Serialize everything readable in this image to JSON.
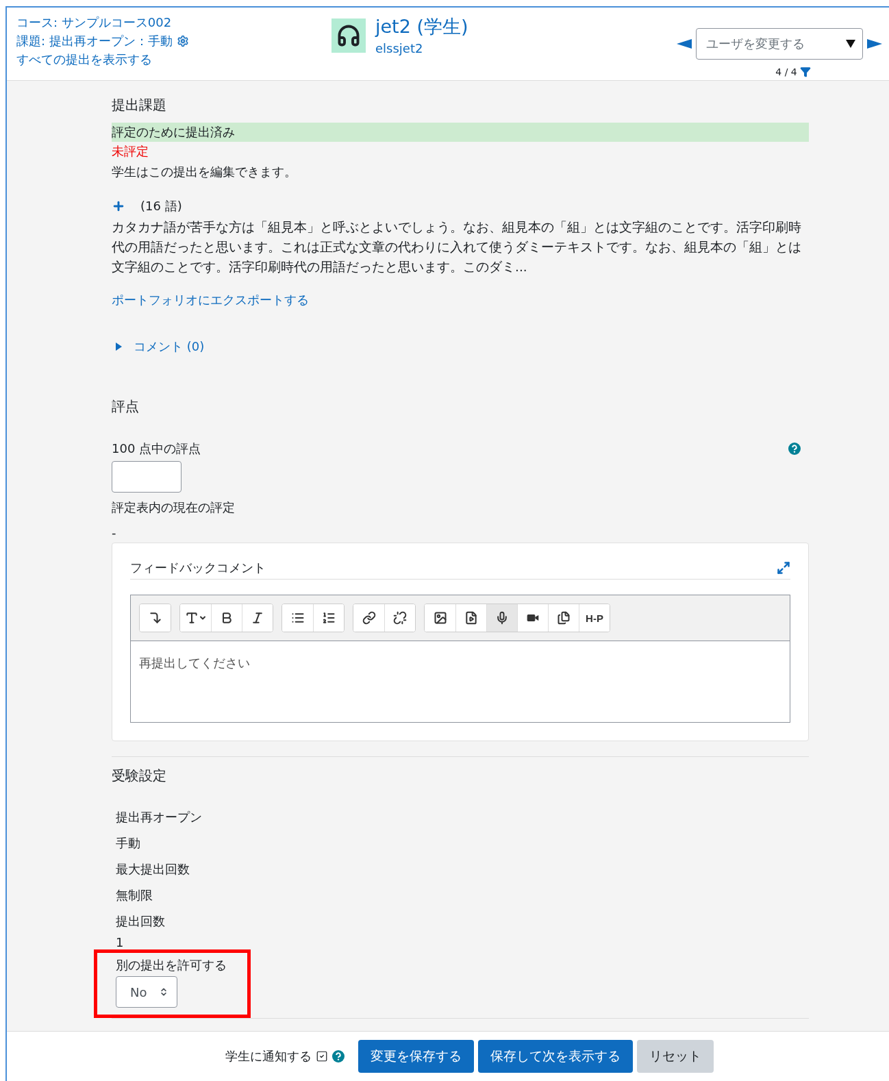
{
  "header": {
    "course_link": "コース: サンプルコース002",
    "assignment_link": "課題: 提出再オープン：手動",
    "all_submissions_link": "すべての提出を表示する",
    "user": {
      "name": "jet2 (学生)",
      "username": "elssjet2"
    },
    "user_select": {
      "placeholder": "ユーザを変更する"
    },
    "counter": "4 / 4"
  },
  "submission": {
    "heading": "提出課題",
    "status": "評定のために提出済み",
    "grading_status": "未評定",
    "edit_note": "学生はこの提出を編集できます。",
    "expanded": false,
    "word_count": "(16 語)",
    "excerpt": "カタカナ語が苦手な方は「組見本」と呼ぶとよいでしょう。なお、組見本の「組」とは文字組のことです。活字印刷時代の用語だったと思います。これは正式な文章の代わりに入れて使うダミーテキストです。なお、組見本の「組」とは文字組のことです。活字印刷時代の用語だったと思います。このダミ...",
    "export_link": "ポートフォリオにエクスポートする",
    "comments": {
      "label": "コメント (0)",
      "expanded": false
    }
  },
  "grade": {
    "heading": "評点",
    "grade_label": "100 点中の評点",
    "current_label": "評定表内の現在の評定",
    "current_value": "-",
    "feedback": {
      "title": "フィードバックコメント",
      "toolbar": [
        [
          {
            "kind": "collapse",
            "pressed": false
          }
        ],
        [
          {
            "kind": "style",
            "pressed": false
          },
          {
            "kind": "bold",
            "pressed": false
          },
          {
            "kind": "italic",
            "pressed": false
          }
        ],
        [
          {
            "kind": "bullets",
            "pressed": false
          },
          {
            "kind": "numbers",
            "pressed": false
          }
        ],
        [
          {
            "kind": "link",
            "pressed": false
          },
          {
            "kind": "unlink",
            "pressed": false
          }
        ],
        [
          {
            "kind": "image",
            "pressed": false
          },
          {
            "kind": "media",
            "pressed": false
          },
          {
            "kind": "audio",
            "pressed": true
          },
          {
            "kind": "video",
            "pressed": false
          },
          {
            "kind": "files",
            "pressed": false
          },
          {
            "kind": "h5p",
            "label": "H-P",
            "pressed": false
          }
        ]
      ],
      "text": "再提出してください"
    }
  },
  "attempt_settings": {
    "heading": "受験設定",
    "items": [
      "提出再オープン",
      "手動",
      "最大提出回数",
      "無制限",
      "提出回数",
      "1"
    ],
    "allow_another": {
      "label": "別の提出を許可する",
      "value": "No",
      "highlighted": true
    }
  },
  "footer": {
    "notify": {
      "label": "学生に通知する",
      "checked": true
    },
    "buttons": [
      {
        "label": "変更を保存する",
        "kind": "primary"
      },
      {
        "label": "保存して次を表示する",
        "kind": "primary"
      },
      {
        "label": "リセット",
        "kind": "secondary"
      }
    ]
  }
}
